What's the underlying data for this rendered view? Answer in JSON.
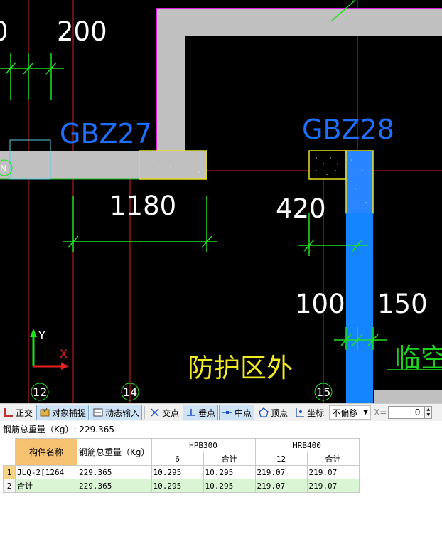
{
  "drawing": {
    "dimensions": [
      "0",
      "200",
      "1180",
      "420",
      "100",
      "150"
    ],
    "tags": [
      "GBZ27",
      "GBZ28"
    ],
    "zone_labels": [
      "防护区外",
      "临空"
    ],
    "axis_numbers": [
      "12",
      "14",
      "15"
    ],
    "ucs": {
      "y": "Y",
      "x": "X"
    },
    "north_mark": "N"
  },
  "toolbar": {
    "ortho": "正交",
    "object_snap": "对象捕捉",
    "dynamic_input": "动态输入",
    "intersection": "交点",
    "perpendicular": "垂点",
    "midpoint": "中点",
    "vertex": "顶点",
    "coordinate": "坐标",
    "offset_mode": "不偏移",
    "x_label": "X=",
    "x_value": "0"
  },
  "summary": {
    "label": "钢筋总重量（Kg）: 229.365"
  },
  "table": {
    "col_name": "构件名称",
    "col_total": "钢筋总重量（Kg）",
    "group1": "HPB300",
    "group2": "HRB400",
    "sub1a": "6",
    "sub1b": "合计",
    "sub2a": "12",
    "sub2b": "合计",
    "rows": [
      {
        "num": "1",
        "name": "JLQ-2[1264",
        "total": "229.365",
        "a": "10.295",
        "b": "10.295",
        "c": "219.07",
        "d": "219.07"
      },
      {
        "num": "2",
        "name": "合计",
        "total": "229.365",
        "a": "10.295",
        "b": "10.295",
        "c": "219.07",
        "d": "219.07"
      }
    ]
  }
}
